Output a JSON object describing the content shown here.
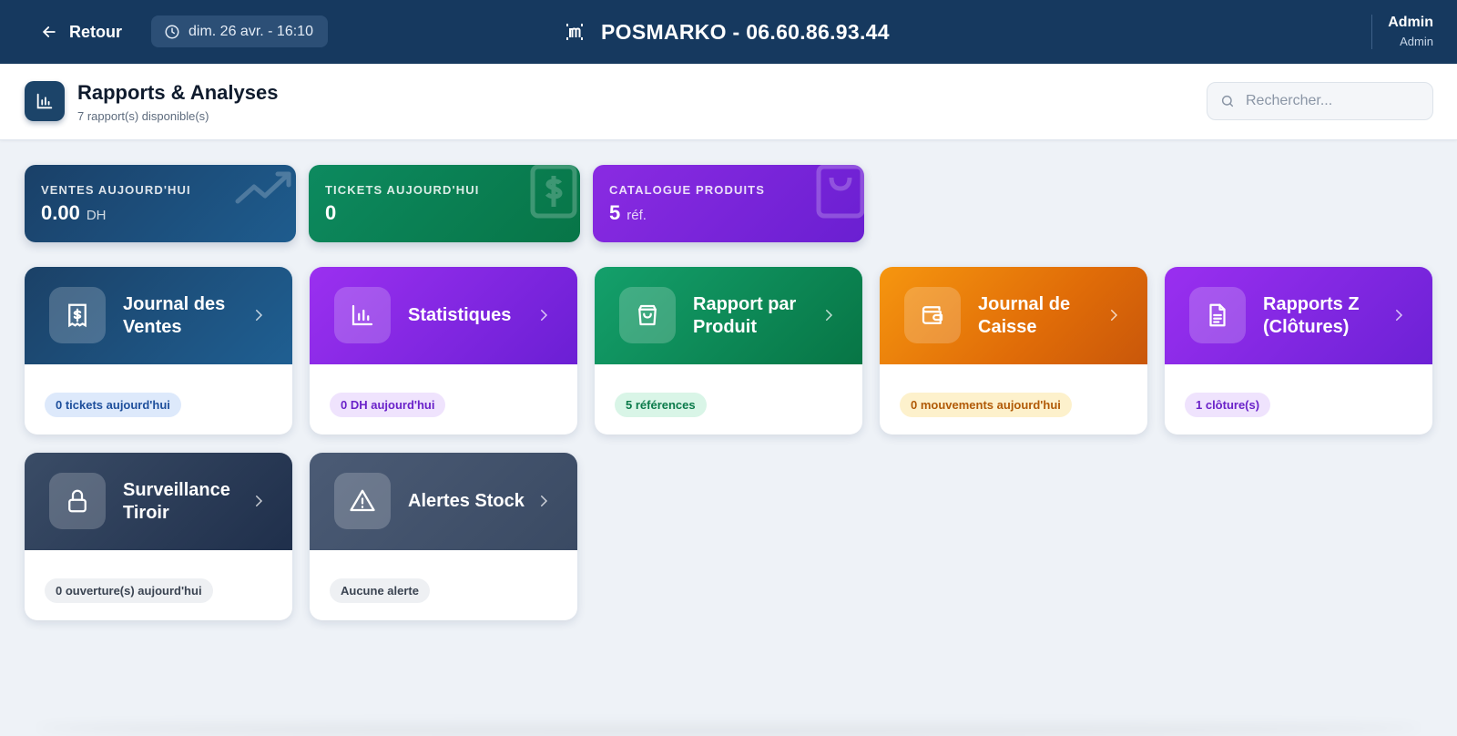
{
  "topbar": {
    "back_label": "Retour",
    "datetime": "dim. 26 avr. - 16:10",
    "brand_title": "POSMARKO - 06.60.86.93.44",
    "user_name": "Admin",
    "user_role": "Admin"
  },
  "header": {
    "title": "Rapports & Analyses",
    "subtitle": "7 rapport(s) disponible(s)",
    "search_placeholder": "Rechercher..."
  },
  "stats": [
    {
      "label": "VENTES AUJOURD'HUI",
      "value": "0.00",
      "unit": "DH",
      "color": "#1a4068"
    },
    {
      "label": "TICKETS AUJOURD'HUI",
      "value": "0",
      "unit": "",
      "color": "#0d8a5f"
    },
    {
      "label": "CATALOGUE PRODUITS",
      "value": "5",
      "unit": "réf.",
      "color": "#8a2be2"
    }
  ],
  "reports": [
    {
      "title": "Journal des Ventes",
      "icon": "receipt-dollar-icon",
      "badge": "0 tickets aujourd'hui",
      "color": "#1b4167"
    },
    {
      "title": "Statistiques",
      "icon": "bar-chart-icon",
      "badge": "0 DH aujourd'hui",
      "color": "#9b30f0"
    },
    {
      "title": "Rapport par Produit",
      "icon": "shopping-bag-icon",
      "badge": "5 références",
      "color": "#14a06b"
    },
    {
      "title": "Journal de Caisse",
      "icon": "wallet-icon",
      "badge": "0 mouvements aujourd'hui",
      "color": "#f6960f"
    },
    {
      "title": "Rapports Z (Clôtures)",
      "icon": "document-icon",
      "badge": "1 clôture(s)",
      "color": "#9a2ff0"
    },
    {
      "title": "Surveillance Tiroir",
      "icon": "lock-icon",
      "badge": "0 ouverture(s) aujourd'hui",
      "color": "#3a4c66"
    },
    {
      "title": "Alertes Stock",
      "icon": "warning-triangle-icon",
      "badge": "Aucune alerte",
      "color": "#4b5b75"
    }
  ]
}
